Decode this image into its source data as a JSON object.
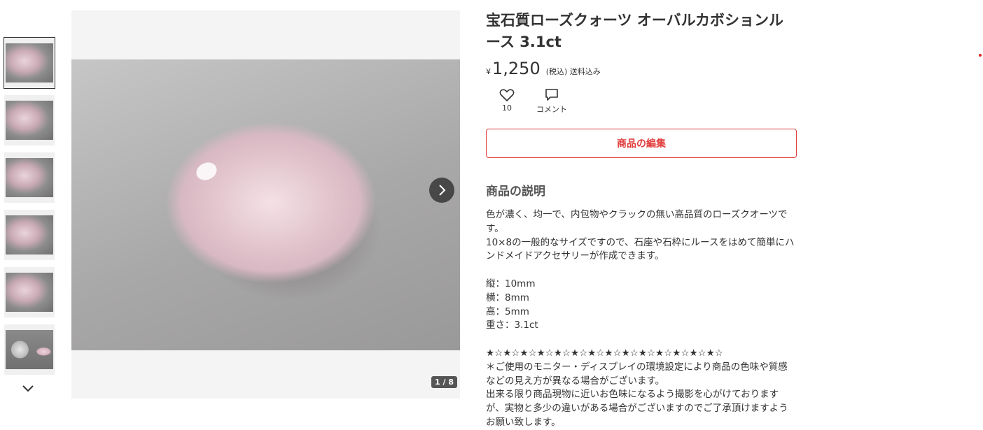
{
  "product": {
    "title": "宝石質ローズクォーツ オーバルカボションルース 3.1ct",
    "currency": "¥",
    "price": "1,250",
    "tax_note": "(税込) 送料込み",
    "likes_count": "10",
    "comment_label": "コメント",
    "edit_label": "商品の編集"
  },
  "gallery": {
    "counter": "1 / 8",
    "thumbnails": [
      "thumb-1",
      "thumb-2",
      "thumb-3",
      "thumb-4",
      "thumb-5",
      "thumb-6"
    ]
  },
  "description": {
    "heading": "商品の説明",
    "text": "色が濃く、均一で、内包物やクラックの無い高品質のローズクオーツです。\n10×8の一般的なサイズですので、石座や石枠にルースをはめて簡単にハンドメイドアクセサリーが作成できます。\n\n縦：10mm\n横：8mm\n高：5mm\n重さ：3.1ct\n\n★☆★☆★☆★☆★☆★☆★☆★☆★☆★☆★☆★☆★☆★☆\n＊ご使用のモニター・ディスプレイの環境設定により商品の色味や質感などの見え方が異なる場合がございます。\n出来る限り商品現物に近いお色味になるよう撮影を心がけておりますが、実物と多少の違いがある場合がございますのでご了承頂けますようお願い致します。"
  },
  "icons": {
    "like": "heart-icon",
    "comment": "speech-bubble-icon",
    "next": "chevron-right-icon",
    "more_thumbs": "chevron-down-icon"
  },
  "colors": {
    "accent": "#e23b3b",
    "text": "#333333"
  }
}
